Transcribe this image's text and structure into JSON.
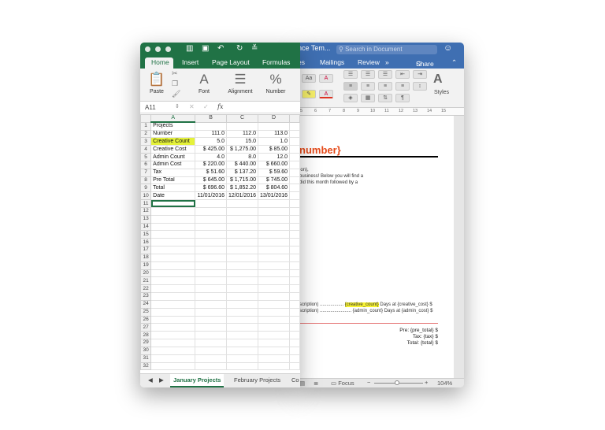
{
  "word": {
    "title": "nce Tem...",
    "search_placeholder": "Search in Document",
    "smiley": "☺",
    "tabs": [
      "es",
      "Mailings",
      "Review",
      "»"
    ],
    "share_label": "Share",
    "styles_label": "Styles",
    "ruler_ticks": [
      "5",
      "6",
      "7",
      "8",
      "9",
      "10",
      "11",
      "12",
      "13",
      "14",
      "15"
    ],
    "heading": "number}",
    "body_lines": [
      "ion),",
      "business! Below you will find a",
      "did this month followed by a"
    ],
    "item_line_1_prefix": "scription) ..................",
    "item_line_1_highlight": "{creative_count}",
    "item_line_1_suffix": "Days at {creative_cost} $",
    "item_line_2": "scription) ........................ {admin_count} Days at {admin_cost} $",
    "totals": [
      "Pre: {pre_total} $",
      "Tax: {tax} $",
      "Total: {total} $"
    ],
    "status_focus": "Focus",
    "zoom_minus": "−",
    "zoom_plus": "+",
    "zoom": "104%"
  },
  "excel": {
    "ribbon_tabs": [
      "Home",
      "Insert",
      "Page Layout",
      "Formulas"
    ],
    "ribbon_groups": [
      "Paste",
      "Font",
      "Alignment",
      "Number"
    ],
    "name_box": "A11",
    "fx_label": "fx",
    "columns": [
      "A",
      "B",
      "C",
      "D"
    ],
    "rows": [
      [
        "1",
        "Projects",
        "",
        "",
        ""
      ],
      [
        "2",
        "Number",
        "111.0",
        "112.0",
        "113.0"
      ],
      [
        "3",
        "Creative Count",
        "5.0",
        "15.0",
        "1.0"
      ],
      [
        "4",
        "Creative Cost",
        "$ 425.00",
        "$ 1,275.00",
        "$ 85.00"
      ],
      [
        "5",
        "Admin Count",
        "4.0",
        "8.0",
        "12.0"
      ],
      [
        "6",
        "Admin Cost",
        "$ 220.00",
        "$ 440.00",
        "$ 660.00"
      ],
      [
        "7",
        "Tax",
        "$ 51.60",
        "$ 137.20",
        "$ 59.60"
      ],
      [
        "8",
        "Pre Total",
        "$ 645.00",
        "$ 1,715.00",
        "$ 745.00"
      ],
      [
        "9",
        "Total",
        "$ 696.60",
        "$ 1,852.20",
        "$ 804.60"
      ],
      [
        "10",
        "Date",
        "11/01/2016",
        "12/01/2016",
        "13/01/2016"
      ],
      [
        "11",
        "",
        "",
        "",
        ""
      ],
      [
        "12",
        "",
        "",
        "",
        ""
      ],
      [
        "13",
        "",
        "",
        "",
        ""
      ],
      [
        "14",
        "",
        "",
        "",
        ""
      ],
      [
        "15",
        "",
        "",
        "",
        ""
      ],
      [
        "16",
        "",
        "",
        "",
        ""
      ],
      [
        "17",
        "",
        "",
        "",
        ""
      ],
      [
        "18",
        "",
        "",
        "",
        ""
      ],
      [
        "19",
        "",
        "",
        "",
        ""
      ],
      [
        "20",
        "",
        "",
        "",
        ""
      ],
      [
        "21",
        "",
        "",
        "",
        ""
      ],
      [
        "22",
        "",
        "",
        "",
        ""
      ],
      [
        "23",
        "",
        "",
        "",
        ""
      ],
      [
        "24",
        "",
        "",
        "",
        ""
      ],
      [
        "25",
        "",
        "",
        "",
        ""
      ],
      [
        "26",
        "",
        "",
        "",
        ""
      ],
      [
        "27",
        "",
        "",
        "",
        ""
      ],
      [
        "28",
        "",
        "",
        "",
        ""
      ],
      [
        "29",
        "",
        "",
        "",
        ""
      ],
      [
        "30",
        "",
        "",
        "",
        ""
      ],
      [
        "31",
        "",
        "",
        "",
        ""
      ],
      [
        "32",
        "",
        "",
        "",
        ""
      ]
    ],
    "sheet_tabs": [
      "January Projects",
      "February Projects",
      "Co"
    ],
    "accent_color": "#207245",
    "highlight_color": "#e5f23a"
  }
}
